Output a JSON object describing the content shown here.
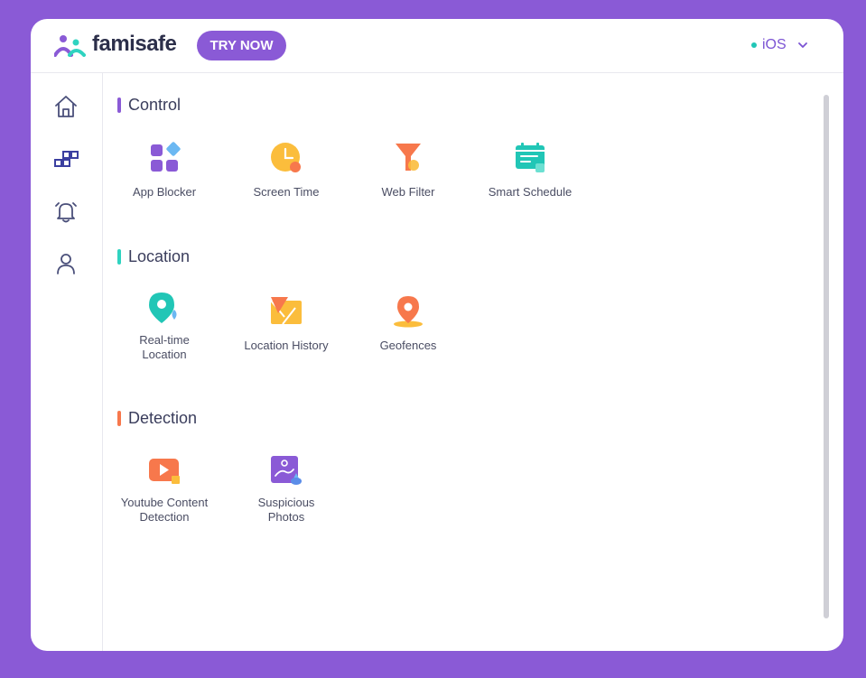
{
  "header": {
    "brand": "famisafe",
    "try_button": "TRY NOW",
    "device": "iOS",
    "colors": {
      "accent": "#8a5ad6",
      "online": "#21c6b6"
    }
  },
  "sidebar": {
    "items": [
      {
        "icon": "home-icon",
        "active": false
      },
      {
        "icon": "apps-grid-icon",
        "active": true
      },
      {
        "icon": "bell-icon",
        "active": false
      },
      {
        "icon": "user-icon",
        "active": false
      }
    ]
  },
  "sections": [
    {
      "title": "Control",
      "color": "#8a5ad6",
      "items": [
        {
          "label": "App Blocker",
          "icon": "app-blocker-icon"
        },
        {
          "label": "Screen Time",
          "icon": "screen-time-icon"
        },
        {
          "label": "Web Filter",
          "icon": "web-filter-icon"
        },
        {
          "label": "Smart Schedule",
          "icon": "smart-schedule-icon"
        }
      ]
    },
    {
      "title": "Location",
      "color": "#2fd3c0",
      "items": [
        {
          "label": "Real-time\nLocation",
          "icon": "location-pin-icon"
        },
        {
          "label": "Location History",
          "icon": "location-history-icon"
        },
        {
          "label": "Geofences",
          "icon": "geofence-icon"
        }
      ]
    },
    {
      "title": "Detection",
      "color": "#f7784c",
      "items": [
        {
          "label": "Youtube Content\nDetection",
          "icon": "youtube-detection-icon"
        },
        {
          "label": "Suspicious\nPhotos",
          "icon": "suspicious-photos-icon"
        }
      ]
    }
  ]
}
